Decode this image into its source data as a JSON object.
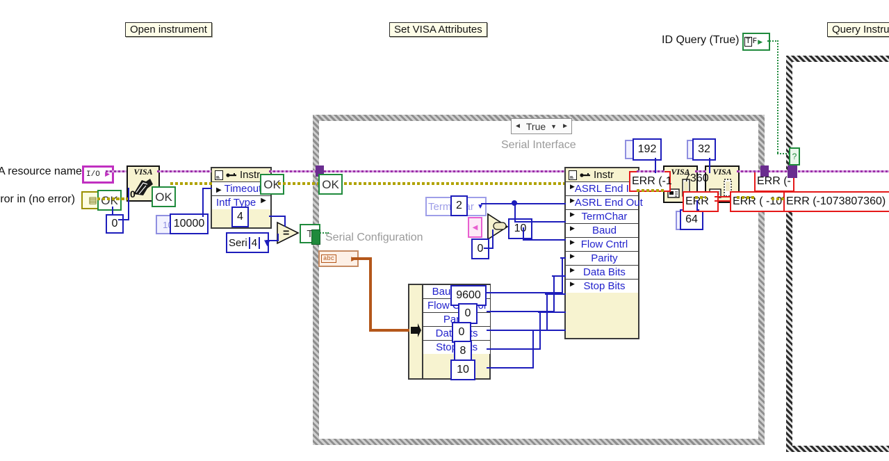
{
  "diagram": {
    "app": "LabVIEW Block Diagram",
    "free_labels": [
      {
        "id": "open-instrument",
        "text": "Open instrument"
      },
      {
        "id": "set-visa-attributes",
        "text": "Set VISA Attributes"
      },
      {
        "id": "query-instrument",
        "text": "Query Instrur"
      }
    ],
    "plain_labels": {
      "id_query": "ID Query (True)",
      "visa_resource_name": "A resource name",
      "error_in": "rror in (no error)"
    },
    "gray_labels": {
      "serial_interface": "Serial Interface",
      "serial_configuration": "Serial Configuration"
    },
    "case_selector": {
      "value": "True",
      "left_arrow": "◄",
      "right_arrow": "►",
      "down_arrow": "▼"
    },
    "terminals": {
      "visa_resource": "I/O",
      "error_in_glyph": "⌗",
      "serial_config_glyph": "abc"
    },
    "status_boxes": {
      "ok": "OK",
      "err_short": "ERR (-",
      "err_1": "ERR (-1",
      "err_2": "ERR",
      "err_3": "ERR (-",
      "err_4": "ERR ( -107",
      "err_full": "ERR (-1073807360)",
      "err_value": "7360",
      "true_glyph": "T",
      "tf_glyph": "T F"
    },
    "constants": {
      "zero_a": "0",
      "timeout_pale": "100",
      "timeout": "10000",
      "intf_type": "4",
      "serial_ring": "Seri",
      "serial_value": "4",
      "termchar_ring": "TermChar",
      "termchar_value": "2",
      "select_true": "10",
      "select_false": "0",
      "count_192_pale": "×0",
      "count_192": "192",
      "count_32_pale": "×",
      "count_32": "32",
      "count_64_pale": "×",
      "count_64": "64",
      "visa_open_zero": "0"
    },
    "property_node_1": {
      "title": "Instr",
      "rows": [
        "Timeout",
        "Intf Type"
      ]
    },
    "property_node_2": {
      "title": "Instr",
      "rows": [
        "ASRL End In",
        "ASRL End Out",
        "TermChar",
        "Baud",
        "Flow Cntrl",
        "Parity",
        "Data Bits",
        "Stop Bits"
      ]
    },
    "unbundle_cluster": {
      "rows": [
        {
          "label": "Baud Rate",
          "value": "9600"
        },
        {
          "label": "Flow Control",
          "value": "0"
        },
        {
          "label": "Parity",
          "value": "0"
        },
        {
          "label": "Data Bits",
          "value": "8"
        },
        {
          "label": "Stop Bits",
          "value": "10"
        }
      ]
    },
    "comparison": {
      "operator": "=",
      "output": "T"
    },
    "colors": {
      "wire_blue": "#1d1dbb",
      "wire_error": "#e51919",
      "wire_visa": "#9b30a8",
      "wire_cluster": "#b0a200",
      "wire_orange": "#b4571a",
      "wire_boolean": "#1f8a3c",
      "node_fill": "#f7f3d0",
      "label_fill": "#fefde8"
    }
  }
}
